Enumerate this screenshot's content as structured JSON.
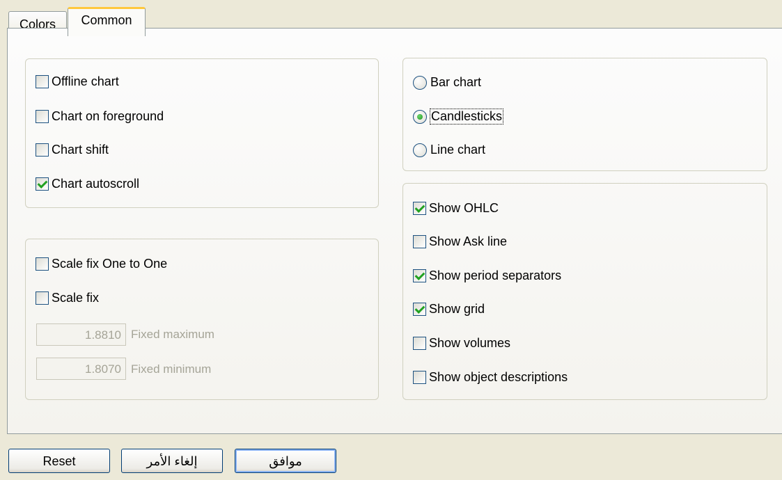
{
  "tabs": [
    {
      "label": "Colors",
      "active": false
    },
    {
      "label": "Common",
      "active": true
    }
  ],
  "chart_options": [
    {
      "label": "Offline chart",
      "checked": false
    },
    {
      "label": "Chart on foreground",
      "checked": false
    },
    {
      "label": "Chart shift",
      "checked": false
    },
    {
      "label": "Chart autoscroll",
      "checked": true
    }
  ],
  "scale_options": [
    {
      "label": "Scale fix One to One",
      "checked": false
    },
    {
      "label": "Scale fix",
      "checked": false
    }
  ],
  "fixed_values": {
    "maximum": {
      "value": "1.8810",
      "label": "Fixed maximum"
    },
    "minimum": {
      "value": "1.8070",
      "label": "Fixed minimum"
    }
  },
  "chart_type": {
    "options": [
      "Bar chart",
      "Candlesticks",
      "Line chart"
    ],
    "selected": "Candlesticks"
  },
  "show_options": [
    {
      "label": "Show OHLC",
      "checked": true
    },
    {
      "label": "Show Ask line",
      "checked": false
    },
    {
      "label": "Show period separators",
      "checked": true
    },
    {
      "label": "Show grid",
      "checked": true
    },
    {
      "label": "Show volumes",
      "checked": false
    },
    {
      "label": "Show object descriptions",
      "checked": false
    }
  ],
  "buttons": {
    "reset": "Reset",
    "cancel": "إلغاء الأمر",
    "ok": "موافق"
  },
  "colors": {
    "check": "#21a121",
    "active_tab_accent": "#ffc83c",
    "disabled_text": "#a5a497"
  }
}
